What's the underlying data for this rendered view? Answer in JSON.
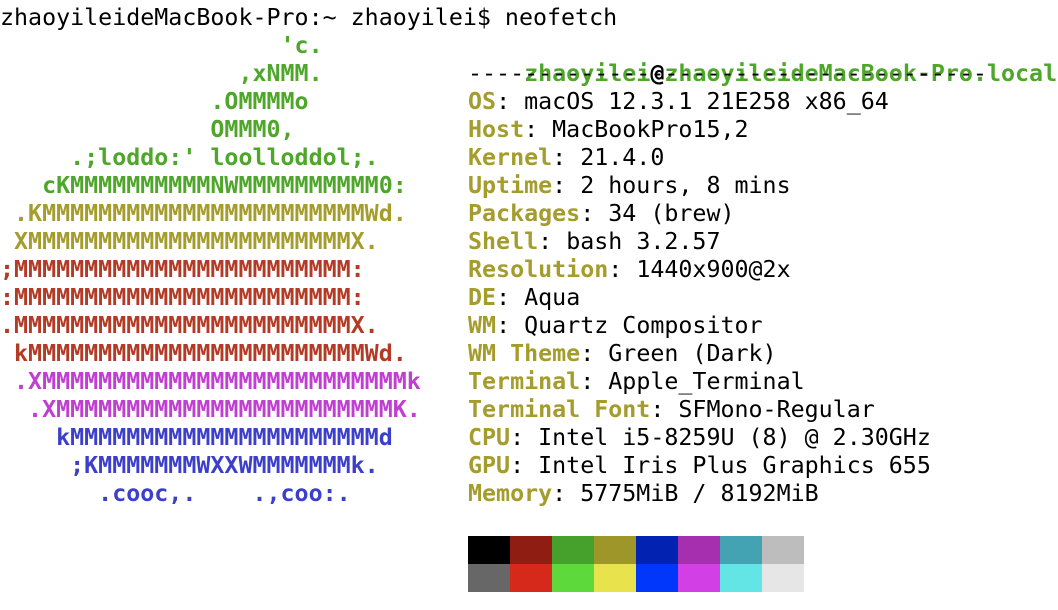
{
  "prompt": {
    "text": "zhaoyileideMacBook-Pro:~ zhaoyilei$ neofetch"
  },
  "logo": {
    "lines": [
      {
        "text": "                    'c.",
        "color": "#4ea62b"
      },
      {
        "text": "                 ,xNMM.",
        "color": "#4ea62b"
      },
      {
        "text": "               .OMMMMo",
        "color": "#4ea62b"
      },
      {
        "text": "               OMMM0,",
        "color": "#4ea62b"
      },
      {
        "text": "     .;loddo:' loolloddol;.",
        "color": "#4ea62b"
      },
      {
        "text": "   cKMMMMMMMMMMNWMMMMMMMMMM0:",
        "color": "#4ea62b"
      },
      {
        "text": " .KMMMMMMMMMMMMMMMMMMMMMMMWd.",
        "color": "#a59c2e"
      },
      {
        "text": " XMMMMMMMMMMMMMMMMMMMMMMMX.",
        "color": "#a59c2e"
      },
      {
        "text": ";MMMMMMMMMMMMMMMMMMMMMMMM:",
        "color": "#b33a24"
      },
      {
        "text": ":MMMMMMMMMMMMMMMMMMMMMMMM:",
        "color": "#b33a24"
      },
      {
        "text": ".MMMMMMMMMMMMMMMMMMMMMMMMX.",
        "color": "#b33a24"
      },
      {
        "text": " kMMMMMMMMMMMMMMMMMMMMMMMMWd.",
        "color": "#b33a24"
      },
      {
        "text": " .XMMMMMMMMMMMMMMMMMMMMMMMMMMk",
        "color": "#c03ed1"
      },
      {
        "text": "  .XMMMMMMMMMMMMMMMMMMMMMMMMK.",
        "color": "#c03ed1"
      },
      {
        "text": "    kMMMMMMMMMMMMMMMMMMMMMMd",
        "color": "#3c3fc9"
      },
      {
        "text": "     ;KMMMMMMMWXXWMMMMMMMk.",
        "color": "#3c3fc9"
      },
      {
        "text": "       .cooc,.    .,coo:.",
        "color": "#3c3fc9"
      }
    ]
  },
  "header": {
    "user": "zhaoyilei",
    "at": "@",
    "host": "zhaoyileideMacBook-Pro.local",
    "separator": "-------------------------------------"
  },
  "info": [
    {
      "label": "OS",
      "value": ": macOS 12.3.1 21E258 x86_64"
    },
    {
      "label": "Host",
      "value": ": MacBookPro15,2"
    },
    {
      "label": "Kernel",
      "value": ": 21.4.0"
    },
    {
      "label": "Uptime",
      "value": ": 2 hours, 8 mins"
    },
    {
      "label": "Packages",
      "value": ": 34 (brew)"
    },
    {
      "label": "Shell",
      "value": ": bash 3.2.57"
    },
    {
      "label": "Resolution",
      "value": ": 1440x900@2x"
    },
    {
      "label": "DE",
      "value": ": Aqua"
    },
    {
      "label": "WM",
      "value": ": Quartz Compositor"
    },
    {
      "label": "WM Theme",
      "value": ": Green (Dark)"
    },
    {
      "label": "Terminal",
      "value": ": Apple_Terminal"
    },
    {
      "label": "Terminal Font",
      "value": ": SFMono-Regular"
    },
    {
      "label": "CPU",
      "value": ": Intel i5-8259U (8) @ 2.30GHz"
    },
    {
      "label": "GPU",
      "value": ": Intel Iris Plus Graphics 655"
    },
    {
      "label": "Memory",
      "value": ": 5775MiB / 8192MiB"
    }
  ],
  "colors": {
    "user_host": "#4ea62b",
    "label": "#a59c2e",
    "text": "#000000",
    "palette_normal": [
      "#000000",
      "#8f1d12",
      "#46a02c",
      "#9f9629",
      "#0223b2",
      "#a52fae",
      "#44a3b2",
      "#bdbdbd"
    ],
    "palette_bright": [
      "#676767",
      "#d6291c",
      "#5ed93c",
      "#e8e24c",
      "#0037fb",
      "#d23fe4",
      "#63e5e5",
      "#e6e6e6"
    ]
  }
}
